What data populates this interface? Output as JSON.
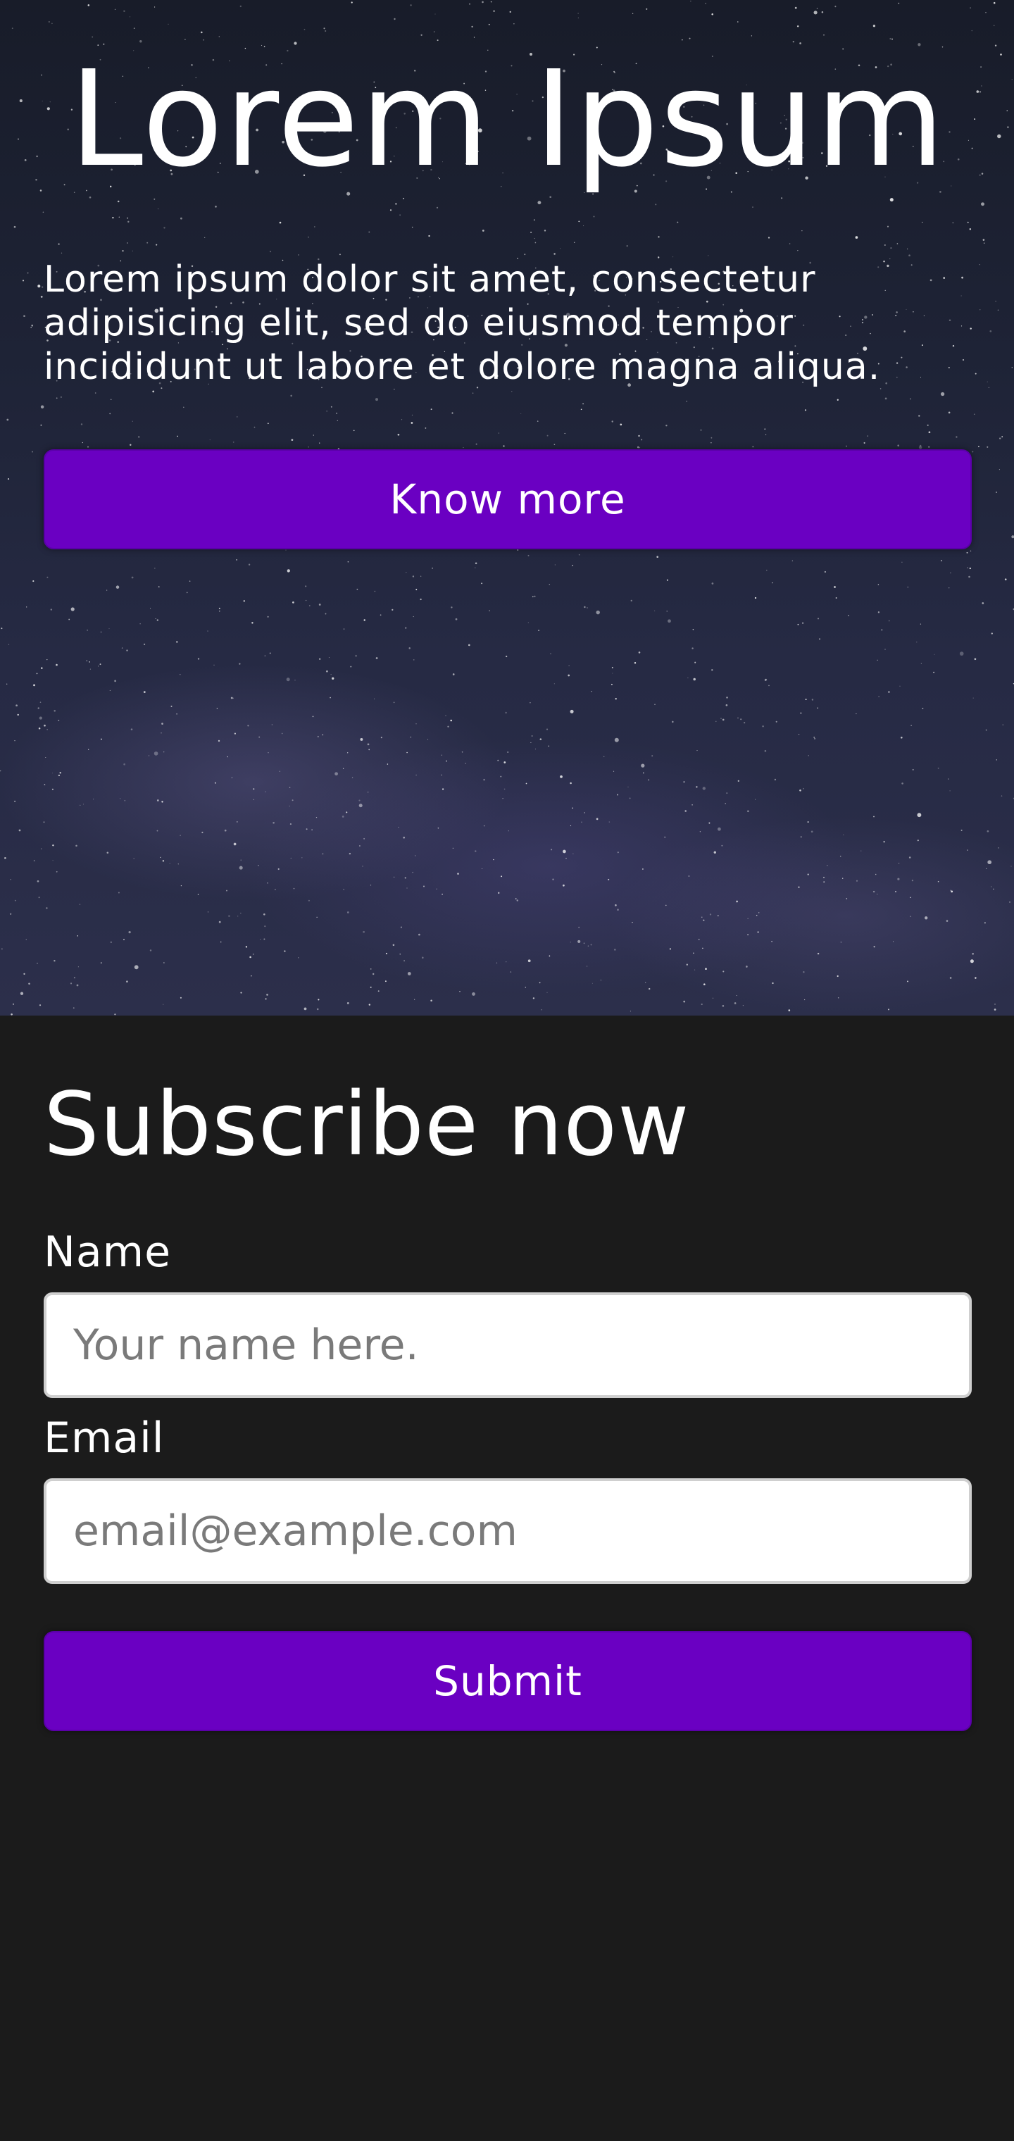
{
  "hero": {
    "title": "Lorem Ipsum",
    "text": "Lorem ipsum dolor sit amet, consectetur adipisicing elit, sed do eiusmod tempor incididunt ut labore et dolore magna aliqua.",
    "button_label": "Know more"
  },
  "subscribe": {
    "title": "Subscribe now",
    "name_label": "Name",
    "name_placeholder": "Your name here.",
    "name_value": "",
    "email_label": "Email",
    "email_placeholder": "email@example.com",
    "email_value": "",
    "submit_label": "Submit"
  },
  "colors": {
    "accent": "#6a00c2",
    "page_background": "#1b1b1b",
    "hero_background": "#1e2336"
  }
}
